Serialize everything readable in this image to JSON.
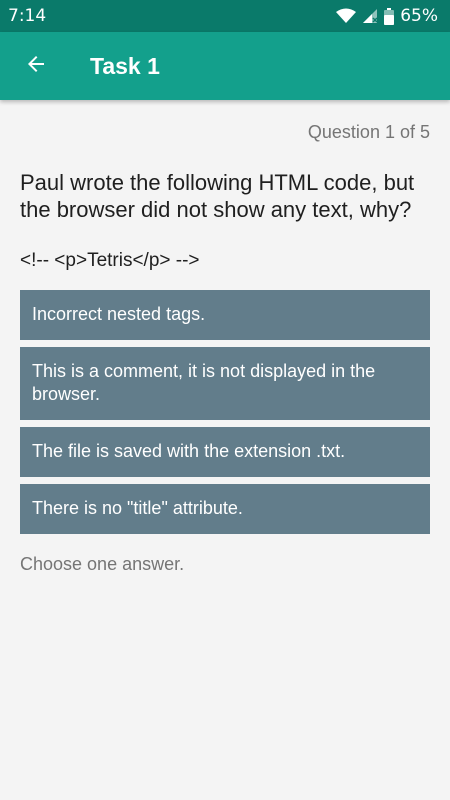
{
  "status_bar": {
    "time": "7:14",
    "battery": "65%",
    "icons": [
      "wifi-icon",
      "signal-icon",
      "battery-icon"
    ]
  },
  "app_bar": {
    "title": "Task 1",
    "back_icon": "arrow-left-icon"
  },
  "quiz": {
    "progress": "Question 1 of 5",
    "question": "Paul wrote the following HTML code, but the browser did not show any text, why?",
    "code": "<!-- <p>Tetris</p> -->",
    "answers": [
      "Incorrect nested tags.",
      "This is a comment, it is not displayed in the browser.",
      "The file is saved with the extension .txt.",
      "There is no \"title\" attribute."
    ],
    "hint": "Choose one answer."
  },
  "colors": {
    "status_bar": "#0a7a6a",
    "app_bar": "#13a08c",
    "answer_bg": "#627d8b",
    "background": "#f4f4f4"
  }
}
